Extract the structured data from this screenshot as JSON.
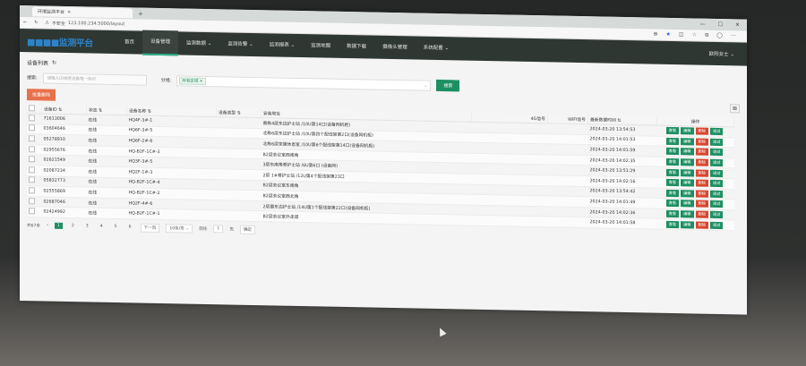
{
  "browser": {
    "tab_title": "环境监测平台",
    "address_label": "不安全",
    "url": "123.100.234.5000/layout"
  },
  "app": {
    "nav": [
      "首页",
      "设备管理",
      "监测数据",
      "监测告警",
      "监测报表",
      "监测地图",
      "数据下载",
      "摄像头管理",
      "系统配置"
    ],
    "user": "欧阳女士"
  },
  "device_list": {
    "title": "设备列表",
    "search_label": "搜索:",
    "search_placeholder": "请输入ID或者设备唯一标识",
    "region_label": "分组:",
    "region_tag": "所有区域",
    "search_button": "搜索",
    "batch_delete": "批量删除",
    "columns": [
      "设备ID",
      "状态",
      "设备名称",
      "设备类型",
      "安装地址",
      "4G信号",
      "WIFI信号",
      "最新数据时间",
      "操作"
    ],
    "rows": [
      {
        "id": "71613006",
        "status": "在线",
        "name": "HQ4F-3#-1",
        "addr": "南栋4层东边护士站 /10U第14口(设备网机柜)",
        "time": "2024-03-20 13:54:53"
      },
      {
        "id": "03604646",
        "status": "在线",
        "name": "HQ6F-3#-5",
        "addr": "北栋6层东边护士站 /10U第四个配线架第2口(设备网机柜)",
        "time": "2024-03-20 14:01:53"
      },
      {
        "id": "05278910",
        "status": "在线",
        "name": "HQ6F-2#-6",
        "addr": "北栋6层家属休息室 /10U第6个配线架第14口(设备网机柜)",
        "time": "2024-03-20 14:01:59"
      },
      {
        "id": "02955676",
        "status": "在线",
        "name": "HQ-B2F-1C#-3",
        "addr": "B2层会议室西南角",
        "time": "2024-03-20 14:02:35"
      },
      {
        "id": "02621549",
        "status": "在线",
        "name": "HQ3F-3#-5",
        "addr": "3层东南角脊护士站 /6U第6口 (设备网)",
        "time": "2024-03-20 13:51:29"
      },
      {
        "id": "02087234",
        "status": "在线",
        "name": "HQ2F-1#-3",
        "addr": "2层 1#脊护士站 /12U第4个配线架第23口",
        "time": "2024-03-20 14:02:16"
      },
      {
        "id": "05832773",
        "status": "在线",
        "name": "HQ-B2F-1C#-4",
        "addr": "B2层会议室东南角",
        "time": "2024-03-20 13:54:42"
      },
      {
        "id": "02555869",
        "status": "在线",
        "name": "HQ-B2F-1C#-2",
        "addr": "B2层会议室西北角",
        "time": "2024-03-20 14:01:49"
      },
      {
        "id": "02687046",
        "status": "在线",
        "name": "HQ2F-4#-6",
        "addr": "2层最东边护士站 /14U第1个配线架第22口(设备网机柜)",
        "time": "2024-03-20 14:02:36"
      },
      {
        "id": "02424992",
        "status": "在线",
        "name": "HQ-B2F-1C#-1",
        "addr": "B2层会议室外走道",
        "time": "2024-03-20 14:01:58"
      }
    ],
    "actions": [
      "查看",
      "编辑",
      "删除",
      "调试"
    ]
  },
  "pagination": {
    "total": "共67条",
    "pages": [
      "1",
      "2",
      "3",
      "4",
      "5",
      "6"
    ],
    "next": "下一页",
    "per_page": "10条/页",
    "goto_label": "前往",
    "goto_value": "1",
    "page_unit": "页",
    "confirm": "确定"
  }
}
